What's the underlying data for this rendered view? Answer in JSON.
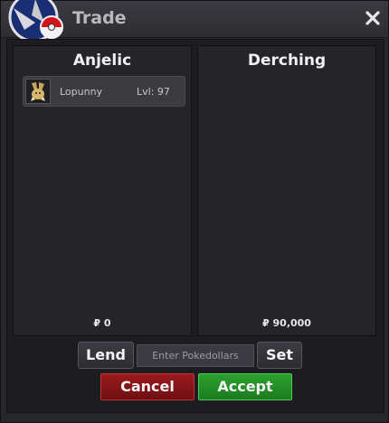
{
  "window": {
    "title": "Trade",
    "close_icon": "close-icon"
  },
  "trade": {
    "left": {
      "player": "Anjelic",
      "items": [
        {
          "name": "Lopunny",
          "level": "Lvl: 97",
          "icon": "lopunny-sprite-icon"
        }
      ],
      "money": "₽ 0"
    },
    "right": {
      "player": "Derching",
      "items": [],
      "money": "₽ 90,000"
    }
  },
  "controls": {
    "lend_label": "Lend",
    "money_placeholder": "Enter Pokedollars",
    "set_label": "Set",
    "cancel_label": "Cancel",
    "accept_label": "Accept"
  },
  "colors": {
    "cancel": "#8a1519",
    "accept": "#249227",
    "window_bg": "#27272b"
  }
}
